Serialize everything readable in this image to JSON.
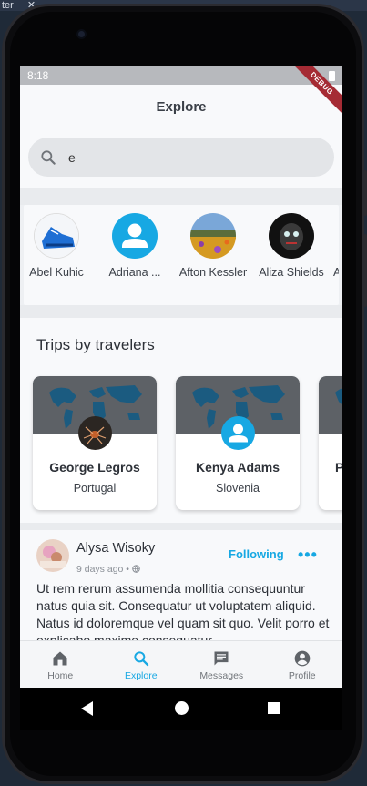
{
  "host": {
    "title_fragment": "ter",
    "close_glyph": "✕"
  },
  "status": {
    "time": "8:18",
    "debug_banner": "DEBUG"
  },
  "appbar": {
    "title": "Explore"
  },
  "search": {
    "value": "e",
    "placeholder": ""
  },
  "people": [
    {
      "name": "Abel Kuhic",
      "avatar": "sneaker-photo"
    },
    {
      "name": "Adriana ...",
      "avatar": "default-person-icon"
    },
    {
      "name": "Afton Kessler",
      "avatar": "flower-field-photo"
    },
    {
      "name": "Aliza Shields",
      "avatar": "dark-mask-photo"
    },
    {
      "name": "A",
      "avatar": ""
    }
  ],
  "trips": {
    "heading": "Trips by travelers",
    "cards": [
      {
        "name": "George Legros",
        "country": "Portugal",
        "avatar": "spider-photo"
      },
      {
        "name": "Kenya Adams",
        "country": "Slovenia",
        "avatar": "default-person-icon"
      },
      {
        "name": "P",
        "country": "",
        "avatar": ""
      }
    ]
  },
  "post": {
    "author": "Alysa Wisoky",
    "time": "9 days ago •",
    "follow_label": "Following",
    "more_label": "•••",
    "text": "Ut rem rerum assumenda mollitia consequuntur natus quia sit. Consequatur ut voluptatem aliquid. Natus id doloremque vel quam sit quo. Velit porro et explicabo maxime consequatur"
  },
  "nav": {
    "items": [
      {
        "label": "Home",
        "icon": "home-icon",
        "active": false
      },
      {
        "label": "Explore",
        "icon": "search-icon",
        "active": true
      },
      {
        "label": "Messages",
        "icon": "message-icon",
        "active": false
      },
      {
        "label": "Profile",
        "icon": "account-circle-icon",
        "active": false
      }
    ]
  },
  "colors": {
    "accent": "#17a8e3",
    "card_map": "#5d6166",
    "map_land": "#1b5b80",
    "debug": "#a52b34"
  }
}
